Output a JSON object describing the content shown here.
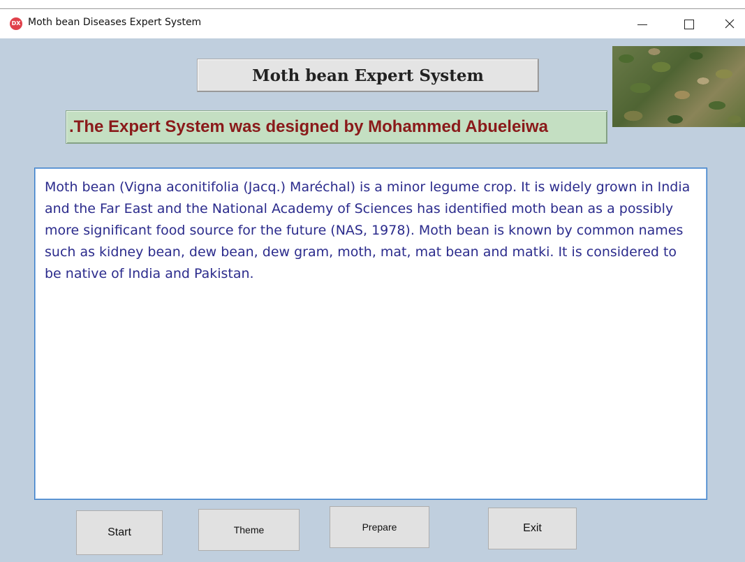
{
  "window": {
    "title": "Moth bean Diseases Expert System",
    "app_icon_text": "DX",
    "controls": {
      "minimize": "minimize-icon",
      "maximize": "maximize-icon",
      "close": "close-icon"
    }
  },
  "header": {
    "title": "Moth bean Expert System",
    "credit": ".The Expert System was designed by Mohammed Abueleiwa"
  },
  "main": {
    "description": "Moth bean (Vigna aconitifolia (Jacq.) Maréchal) is a minor legume crop. It is widely grown in India and the Far East and the National Academy of Sciences has identified moth bean as a possibly more significant food source for the future (NAS, 1978). Moth bean is known by common names such as kidney bean, dew bean, dew gram, moth, mat, mat bean and matki. It is considered to be native of India and Pakistan."
  },
  "buttons": {
    "start": "Start",
    "theme": "Theme",
    "prepare": "Prepare",
    "exit": "Exit"
  },
  "colors": {
    "background": "#c0cfde",
    "credit_text": "#8a1a1a",
    "credit_bg": "#c4dfc2",
    "body_text": "#2b2b8c",
    "text_border": "#3b7fc9"
  }
}
